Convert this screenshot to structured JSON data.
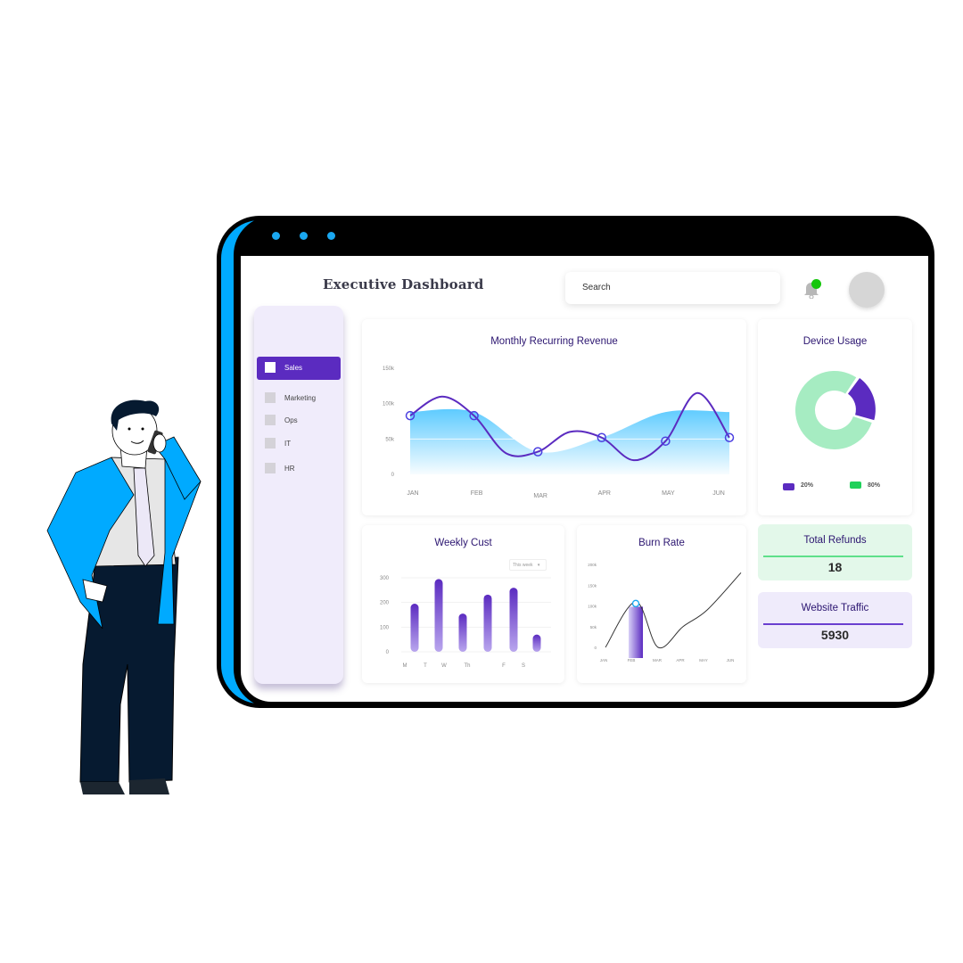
{
  "window": {
    "dots": [
      "window-dot-1",
      "window-dot-2",
      "window-dot-3"
    ],
    "accent_color": "#00aaff"
  },
  "header": {
    "title": "Executive Dashboard",
    "search_placeholder": "Search",
    "notification_indicator_color": "#16c60c"
  },
  "sidebar": {
    "items": [
      {
        "label": "Sales",
        "active": true
      },
      {
        "label": "Marketing",
        "active": false
      },
      {
        "label": "Ops",
        "active": false
      },
      {
        "label": "IT",
        "active": false
      },
      {
        "label": "HR",
        "active": false
      }
    ],
    "active_color": "#5b2bc0"
  },
  "stats": {
    "refunds": {
      "title": "Total  Refunds",
      "value": "18",
      "color": "#e3f8ea",
      "line_color": "#5ee08a"
    },
    "traffic": {
      "title": "Website Traffic",
      "value": "5930",
      "color": "#efebfb",
      "line_color": "#6a3fd0"
    }
  },
  "chart_data": [
    {
      "id": "mrr",
      "type": "line",
      "title": "Monthly Recurring Revenue",
      "categories": [
        "JAN",
        "FEB",
        "MAR",
        "APR",
        "MAY",
        "JUN"
      ],
      "series": [
        {
          "name": "Revenue",
          "values": [
            83000,
            83000,
            32000,
            52000,
            47000,
            52000
          ]
        }
      ],
      "area_values": [
        88000,
        88000,
        32000,
        52000,
        88000,
        88000
      ],
      "y_ticks": [
        "0",
        "50k",
        "100k",
        "150k"
      ],
      "ylim": [
        0,
        150000
      ],
      "line_color": "#5b2bc0",
      "area_color": "#5ecbff"
    },
    {
      "id": "device",
      "type": "pie",
      "title": "Device Usage",
      "labels": [
        "20%",
        "80%"
      ],
      "values": [
        20,
        80
      ],
      "colors": [
        "#5b2bc0",
        "#a6ecc2"
      ],
      "legend_colors": [
        "#5b2bc0",
        "#1fd15a"
      ],
      "legend": "bottom"
    },
    {
      "id": "weekly",
      "type": "bar",
      "title": "Weekly Cust",
      "dropdown_value": "This week",
      "categories": [
        "M",
        "T",
        "W",
        "Th",
        "F",
        "S",
        ""
      ],
      "tick_labels": [
        "M",
        "T",
        "W",
        "Th",
        "F",
        "S"
      ],
      "values": [
        195,
        295,
        155,
        232,
        260,
        70
      ],
      "y_ticks": [
        "0",
        "100",
        "200",
        "300"
      ],
      "ylim": [
        0,
        300
      ],
      "bar_color": "#5b2bc0"
    },
    {
      "id": "burn",
      "type": "line",
      "title": "Burn Rate",
      "categories": [
        "JAN",
        "FEB",
        "MAR",
        "APR",
        "MAY",
        "JUN"
      ],
      "series": [
        {
          "name": "Burn",
          "values": [
            0,
            110000,
            0,
            50000,
            90000,
            180000
          ]
        }
      ],
      "highlight_index": 1,
      "y_ticks": [
        "0",
        "50k",
        "100k",
        "150k",
        "200k"
      ],
      "ylim": [
        0,
        200000
      ],
      "line_color": "#333333",
      "highlight_color": "#1aa7f0"
    }
  ]
}
